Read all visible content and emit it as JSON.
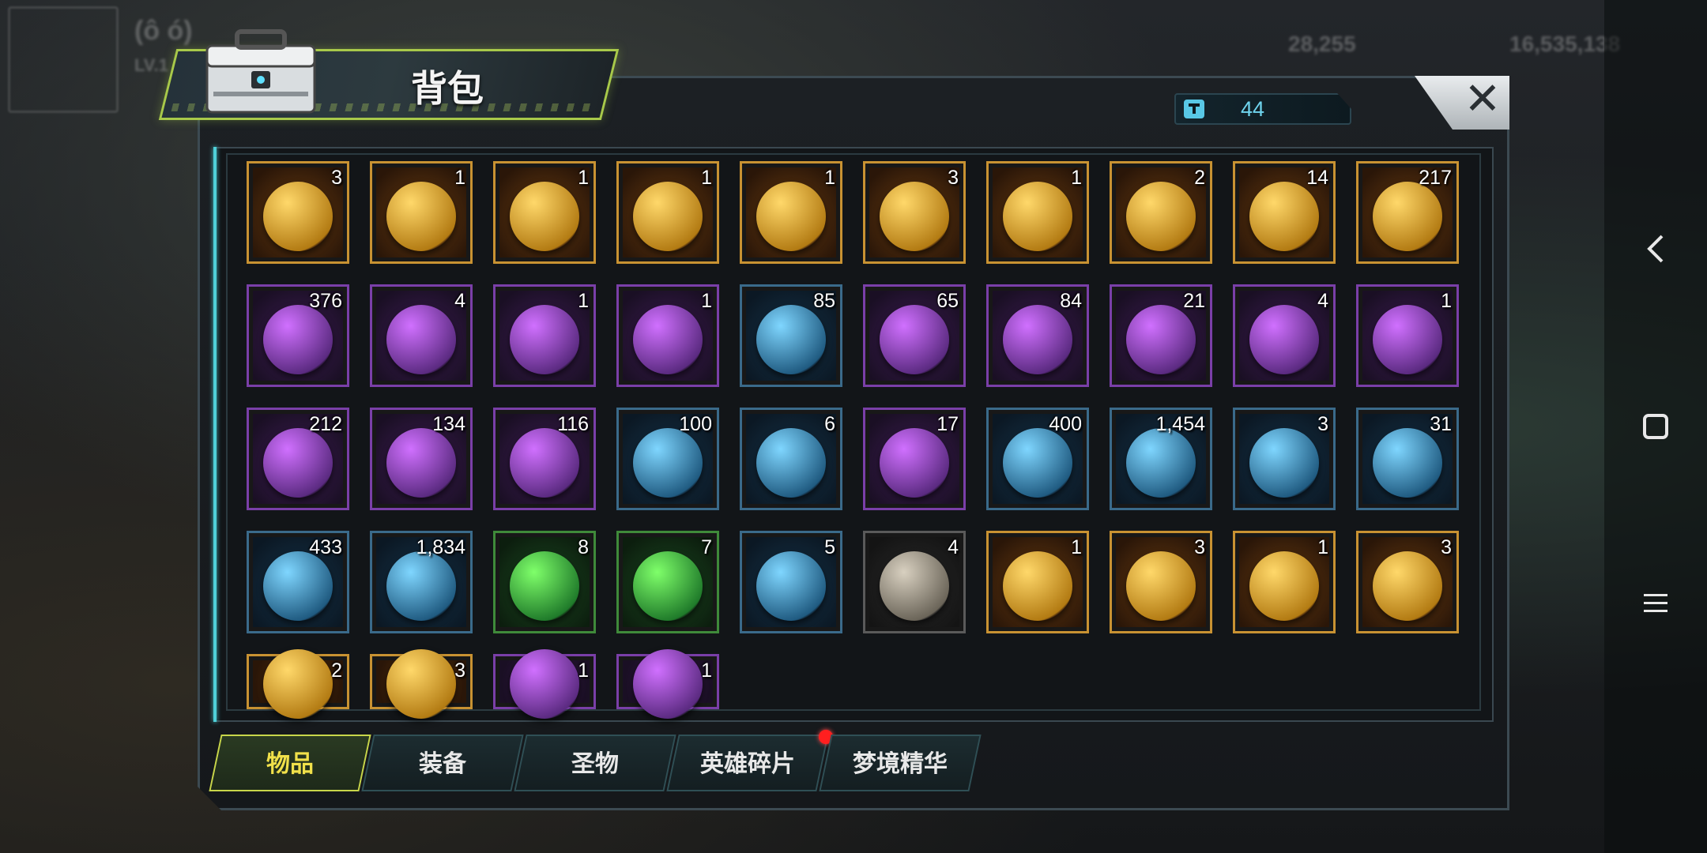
{
  "background": {
    "hud_gold_left": "28,255",
    "hud_gold_right": "16,535,138",
    "player_level": "LV.1",
    "player_name": "(ô ó)"
  },
  "panel": {
    "title": "背包",
    "capacity_count": "44"
  },
  "items": [
    {
      "count": "3",
      "rarity": "gold",
      "icon": "golden-pumpkin"
    },
    {
      "count": "1",
      "rarity": "gold",
      "icon": "mystery-chest"
    },
    {
      "count": "1",
      "rarity": "gold",
      "icon": "purple-mask-medal"
    },
    {
      "count": "1",
      "rarity": "gold",
      "icon": "green-plague-mask"
    },
    {
      "count": "1",
      "rarity": "gold",
      "icon": "gold-token"
    },
    {
      "count": "3",
      "rarity": "gold",
      "icon": "radiation-token"
    },
    {
      "count": "1",
      "rarity": "gold",
      "icon": "gem-minecart"
    },
    {
      "count": "2",
      "rarity": "gold",
      "icon": "gold-treasure-chest"
    },
    {
      "count": "14",
      "rarity": "gold",
      "icon": "24h-card"
    },
    {
      "count": "217",
      "rarity": "gold",
      "icon": "neon-bottle-cap"
    },
    {
      "count": "376",
      "rarity": "purple",
      "icon": "orange-pumpkin"
    },
    {
      "count": "4",
      "rarity": "purple",
      "icon": "skull-axe"
    },
    {
      "count": "1",
      "rarity": "purple",
      "icon": "stone-ring"
    },
    {
      "count": "1",
      "rarity": "purple",
      "icon": "green-cap-fries"
    },
    {
      "count": "85",
      "rarity": "blue",
      "icon": "clover-coin"
    },
    {
      "count": "65",
      "rarity": "purple",
      "icon": "film-reel"
    },
    {
      "count": "84",
      "rarity": "purple",
      "icon": "spray-can"
    },
    {
      "count": "21",
      "rarity": "purple",
      "icon": "12h-card-purple"
    },
    {
      "count": "4",
      "rarity": "purple",
      "icon": "12h-card-gold"
    },
    {
      "count": "1",
      "rarity": "purple",
      "icon": "bottle"
    },
    {
      "count": "212",
      "rarity": "purple",
      "icon": "pink-bottle-cap"
    },
    {
      "count": "134",
      "rarity": "purple",
      "icon": "spade-chip"
    },
    {
      "count": "116",
      "rarity": "purple",
      "icon": "police-badge"
    },
    {
      "count": "100",
      "rarity": "blue",
      "icon": "bolt"
    },
    {
      "count": "6",
      "rarity": "blue",
      "icon": "green-hat"
    },
    {
      "count": "17",
      "rarity": "purple",
      "icon": "syringe"
    },
    {
      "count": "400",
      "rarity": "blue",
      "icon": "pyramid"
    },
    {
      "count": "1,454",
      "rarity": "blue",
      "icon": "cinema-ticket"
    },
    {
      "count": "3",
      "rarity": "blue",
      "icon": "timer-coin"
    },
    {
      "count": "31",
      "rarity": "blue",
      "icon": "blue-bottle-cap"
    },
    {
      "count": "433",
      "rarity": "blue",
      "icon": "red-chip"
    },
    {
      "count": "1,834",
      "rarity": "blue",
      "icon": "bullet"
    },
    {
      "count": "8",
      "rarity": "green",
      "icon": "snorkel-mask"
    },
    {
      "count": "7",
      "rarity": "green",
      "icon": "green-cap"
    },
    {
      "count": "5",
      "rarity": "blue",
      "icon": "4h-card"
    },
    {
      "count": "4",
      "rarity": "grey",
      "icon": "stone-fragment"
    },
    {
      "count": "1",
      "rarity": "gold",
      "icon": "swords-blueprint"
    },
    {
      "count": "3",
      "rarity": "gold",
      "icon": "cowboy-hat-blueprint"
    },
    {
      "count": "1",
      "rarity": "gold",
      "icon": "shirt-blueprint"
    },
    {
      "count": "3",
      "rarity": "gold",
      "icon": "glasses-blueprint"
    },
    {
      "count": "2",
      "rarity": "gold",
      "icon": "gun-blueprint"
    },
    {
      "count": "3",
      "rarity": "gold",
      "icon": "pants-blueprint"
    },
    {
      "count": "1",
      "rarity": "purple",
      "icon": "purple-blueprint-a"
    },
    {
      "count": "1",
      "rarity": "purple",
      "icon": "purple-blueprint-b"
    }
  ],
  "tabs": [
    {
      "label": "物品",
      "active": true
    },
    {
      "label": "装备",
      "active": false
    },
    {
      "label": "圣物",
      "active": false
    },
    {
      "label": "英雄碎片",
      "active": false,
      "notification": true
    },
    {
      "label": "梦境精华",
      "active": false
    }
  ],
  "colors": {
    "gold": "#c8922a",
    "purple": "#8a3fb8",
    "blue": "#2f6a9a",
    "green": "#3f8a3a",
    "grey": "#5a5a5a",
    "accent": "#c8d64a"
  },
  "nav": {
    "back_icon": "back-icon",
    "home_icon": "home-icon",
    "menu_icon": "menu-icon"
  }
}
